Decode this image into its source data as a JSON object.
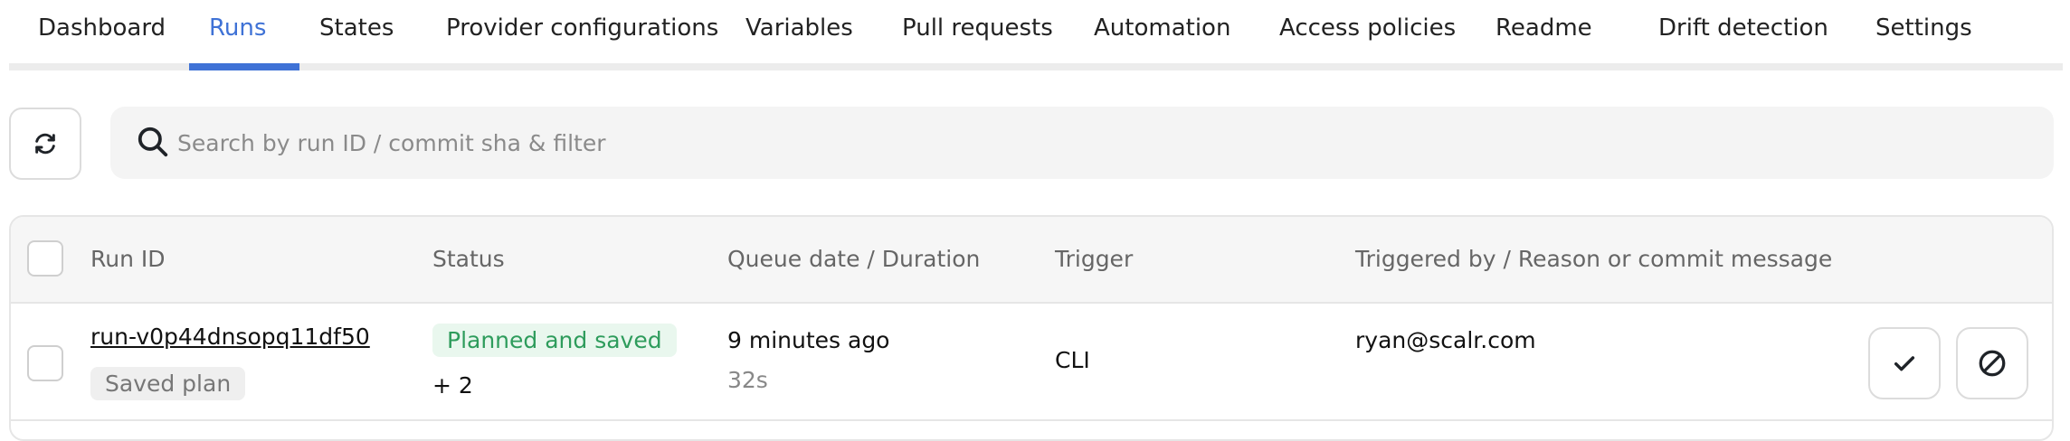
{
  "tabs": [
    {
      "label": "Dashboard"
    },
    {
      "label": "Runs"
    },
    {
      "label": "States"
    },
    {
      "label": "Provider configurations"
    },
    {
      "label": "Variables"
    },
    {
      "label": "Pull requests"
    },
    {
      "label": "Automation"
    },
    {
      "label": "Access policies"
    },
    {
      "label": "Readme"
    },
    {
      "label": "Drift detection"
    },
    {
      "label": "Settings"
    }
  ],
  "active_tab": "Runs",
  "colors": {
    "accent": "#3f72d6",
    "status_planned": "#2e9c5c"
  },
  "toolbar": {
    "refresh_icon": "refresh-icon",
    "search_icon": "search-icon",
    "search_placeholder": "Search by run ID / commit sha & filter",
    "search_value": ""
  },
  "table": {
    "columns": [
      "Run ID",
      "Status",
      "Queue date / Duration",
      "Trigger",
      "Triggered by / Reason or commit message"
    ],
    "rows": [
      {
        "run_id": "run-v0p44dnsopq11df50",
        "run_tag": "Saved plan",
        "status": "Planned and saved",
        "status_extra": "+ 2",
        "queue_date": "9 minutes ago",
        "duration": "32s",
        "trigger": "CLI",
        "triggered_by": "ryan@scalr.com",
        "actions": [
          "check-icon",
          "cancel-icon"
        ]
      }
    ]
  }
}
